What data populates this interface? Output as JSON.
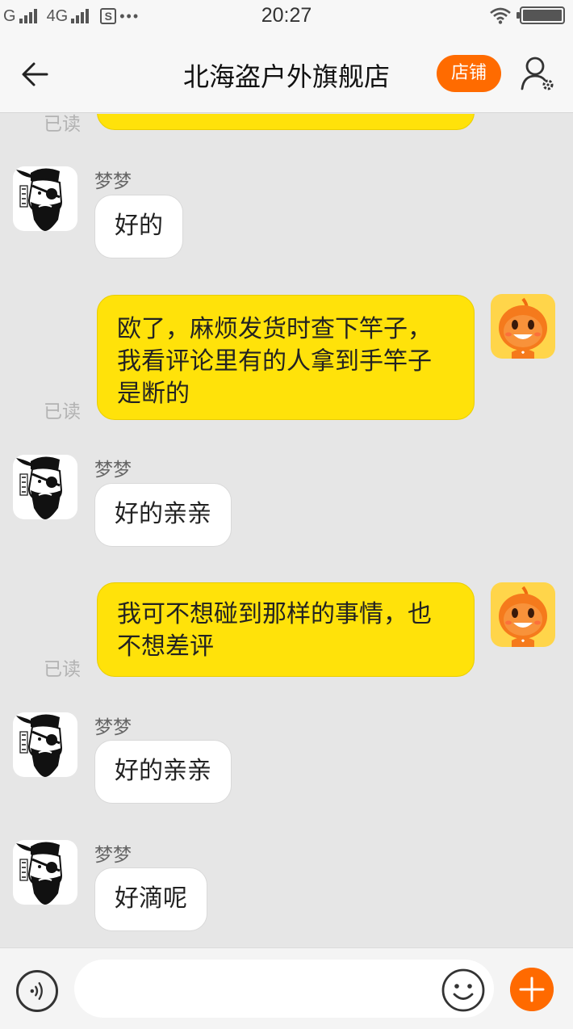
{
  "status_bar": {
    "carrier1": "G",
    "carrier2": "4G",
    "sim_label": "S",
    "more": "•••",
    "time": "20:27"
  },
  "header": {
    "title": "北海盗户外旗舰店",
    "shop_button": "店铺"
  },
  "messages": [
    {
      "side": "right",
      "read": "已读",
      "text": ""
    },
    {
      "side": "left",
      "sender": "梦梦",
      "text": "好的"
    },
    {
      "side": "right",
      "read": "已读",
      "lines": [
        "欧了，麻烦发货时查下竿子，",
        "我看评论里有的人拿到手竿子",
        "是断的"
      ]
    },
    {
      "side": "left",
      "sender": "梦梦",
      "text": "好的亲亲"
    },
    {
      "side": "right",
      "read": "已读",
      "lines": [
        "我可不想碰到那样的事情，也",
        "不想差评"
      ]
    },
    {
      "side": "left",
      "sender": "梦梦",
      "text": "好的亲亲"
    },
    {
      "side": "left",
      "sender": "梦梦",
      "text": "好滴呢"
    }
  ],
  "input": {
    "placeholder": ""
  },
  "colors": {
    "accent": "#ff6b00",
    "bubble_own": "#ffe20a",
    "background": "#e6e6e6"
  },
  "icons": [
    "back-arrow-icon",
    "user-settings-icon",
    "voice-icon",
    "emoji-icon",
    "plus-icon"
  ]
}
